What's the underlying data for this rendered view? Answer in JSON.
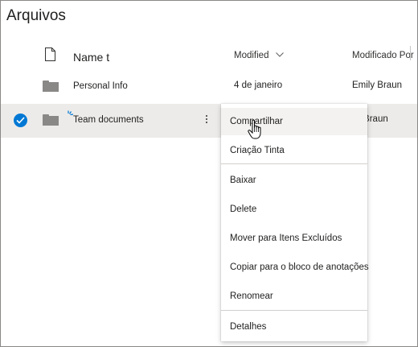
{
  "title": "Arquivos",
  "columns": {
    "name": "Name t",
    "modified": "Modified",
    "modified_by": "Modificado Por"
  },
  "rows": [
    {
      "name": "Personal Info",
      "modified": "4 de janeiro",
      "modified_by": "Emily Braun",
      "selected": false
    },
    {
      "name": "Team documents",
      "modified": "",
      "modified_by": "ily Braun",
      "selected": true
    }
  ],
  "context_menu": {
    "items": [
      "Compartilhar",
      "Criação Tinta",
      "Baixar",
      "Delete",
      "Mover para Itens Excluídos",
      "Copiar para o bloco de anotações",
      "Renomear",
      "Detalhes"
    ]
  },
  "colors": {
    "accent": "#0078d4",
    "selected_row": "#edebe9",
    "folder": "#8a8886"
  },
  "icons": [
    "document-icon",
    "chevron-down-icon",
    "folder-icon",
    "checkmark-icon",
    "new-item-spark-icon",
    "more-options-icon",
    "hand-pointer-icon"
  ]
}
